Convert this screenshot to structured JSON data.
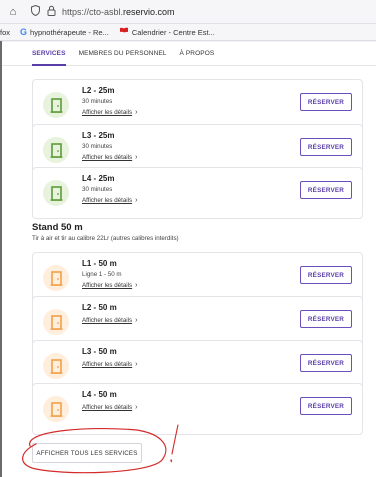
{
  "browser": {
    "url_prefix": "https://cto-asbl.",
    "url_domain": "reservio.com",
    "bookmarks": [
      {
        "label": "fox",
        "icon": ""
      },
      {
        "label": "hypnothérapeute - Re...",
        "icon": "G"
      },
      {
        "label": "Calendrier - Centre Est...",
        "icon": "flag"
      }
    ]
  },
  "tabs": [
    "SERVICES",
    "MEMBRES DU PERSONNEL",
    "À PROPOS"
  ],
  "services_25m": [
    {
      "title": "L2 - 25m",
      "subtitle": "30 minutes",
      "link": "Afficher les détails",
      "button": "RÉSERVER"
    },
    {
      "title": "L3 - 25m",
      "subtitle": "30 minutes",
      "link": "Afficher les détails",
      "button": "RÉSERVER"
    },
    {
      "title": "L4 - 25m",
      "subtitle": "30 minutes",
      "link": "Afficher les détails",
      "button": "RÉSERVER"
    }
  ],
  "stand50": {
    "title": "Stand 50 m",
    "description": "Tir à air et tir au calibre 22Lr (autres calibres interdits)"
  },
  "services_50m": [
    {
      "title": "L1 - 50 m",
      "subtitle": "Ligne 1 - 50 m",
      "link": "Afficher les détails",
      "button": "RÉSERVER"
    },
    {
      "title": "L2 - 50 m",
      "subtitle": "",
      "link": "Afficher les détails",
      "button": "RÉSERVER"
    },
    {
      "title": "L3 - 50 m",
      "subtitle": "",
      "link": "Afficher les détails",
      "button": "RÉSERVER"
    },
    {
      "title": "L4 - 50 m",
      "subtitle": "",
      "link": "Afficher les détails",
      "button": "RÉSERVER"
    }
  ],
  "show_all_label": "AFFICHER TOUS LES SERVICES",
  "colors": {
    "accent": "#5a3ea8",
    "icon_green": "#5e9a3a",
    "icon_orange": "#f0a04a"
  }
}
